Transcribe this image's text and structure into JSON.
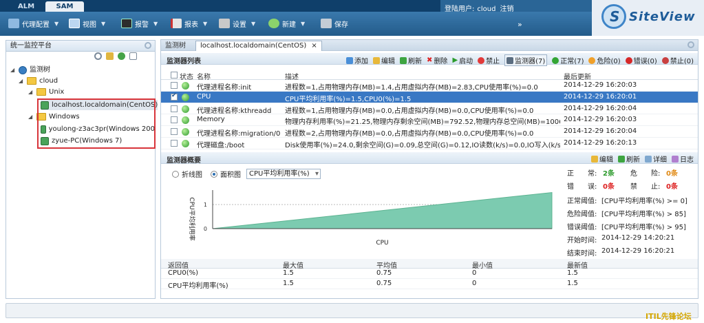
{
  "top_tabs": [
    "ALM",
    "SAM"
  ],
  "user": {
    "label": "登陆用户:",
    "name": "cloud",
    "logout": "注销"
  },
  "toolbar": {
    "items": [
      "代理配置",
      "视图",
      "报警",
      "报表",
      "设置",
      "新建",
      "保存"
    ],
    "expand": "»"
  },
  "logo": {
    "text": "SiteView"
  },
  "left_panel": {
    "title": "统一监控平台",
    "tree": [
      {
        "label": "监测树",
        "level": 0,
        "type": "root"
      },
      {
        "label": "cloud",
        "level": 1,
        "type": "folder"
      },
      {
        "label": "Unix",
        "level": 2,
        "type": "folder"
      },
      {
        "label": "localhost.localdomain(CentOS)",
        "level": 3,
        "type": "host",
        "selected": true
      },
      {
        "label": "Windows",
        "level": 2,
        "type": "folder"
      },
      {
        "label": "youlong-z3ac3pr(Windows 200",
        "level": 3,
        "type": "host"
      },
      {
        "label": "zyue-PC(Windows 7)",
        "level": 3,
        "type": "host"
      }
    ]
  },
  "main": {
    "tabs": [
      {
        "label": "监测树"
      },
      {
        "label": "localhost.localdomain(CentOS)",
        "close": "×"
      }
    ],
    "list": {
      "title": "监测器列表",
      "actions": [
        "添加",
        "编辑",
        "刷新",
        "删除",
        "启动",
        "禁止"
      ],
      "counts": {
        "monitor": "监测器(7)",
        "normal": "正常(7)",
        "danger": "危险(0)",
        "error": "错误(0)",
        "disabled": "禁止(0)"
      },
      "columns": [
        "状态",
        "名称",
        "描述",
        "最后更新"
      ],
      "rows": [
        {
          "name": "代理进程名称:init",
          "desc": "进程数=1,占用物理内存(MB)=1.4,占用虚拟内存(MB)=2.83,CPU使用率(%)=0.0",
          "time": "2014-12-29 16:20:03",
          "checked": false,
          "selected": false
        },
        {
          "name": "CPU",
          "desc": "CPU平均利用率(%)=1.5,CPU0(%)=1.5",
          "time": "2014-12-29 16:20:01",
          "checked": true,
          "selected": true
        },
        {
          "name": "代理进程名称:kthreadd",
          "desc": "进程数=1,占用物理内存(MB)=0.0,占用虚拟内存(MB)=0.0,CPU使用率(%)=0.0",
          "time": "2014-12-29 16:20:04",
          "checked": false,
          "selected": false
        },
        {
          "name": "Memory",
          "desc": "物理内存利用率(%)=21.25,物理内存剩余空间(MB)=792.52,物理内存总空间(MB)=1006.38,¢",
          "time": "2014-12-29 16:20:03",
          "checked": false,
          "selected": false
        },
        {
          "name": "代理进程名称:migration/0",
          "desc": "进程数=2,占用物理内存(MB)=0.0,占用虚拟内存(MB)=0.0,CPU使用率(%)=0.0",
          "time": "2014-12-29 16:20:04",
          "checked": false,
          "selected": false
        },
        {
          "name": "代理磁盘:/boot",
          "desc": "Disk使用率(%)=24.0,剩余空间(G)=0.09,总空间(G)=0.12,IO读数(k/s)=0.0,IO写入(k/s)=0.(",
          "time": "2014-12-29 16:20:13",
          "checked": false,
          "selected": false
        }
      ]
    },
    "summary": {
      "title": "监测器概要",
      "actions": [
        "编辑",
        "刷新",
        "详细",
        "日志"
      ],
      "view_line": "折线图",
      "view_area": "面积图",
      "metric_select": "CPU平均利用率(%)",
      "stats": {
        "normal_label": "正　　常:",
        "normal_value": "2条",
        "danger_label": "危　　险:",
        "danger_value": "0条",
        "error_label": "错　　误:",
        "error_value": "0条",
        "disabled_label": "禁　　止:",
        "disabled_value": "0条",
        "thresholds": [
          {
            "label": "正常阈值:",
            "value": "[CPU平均利用率(%) >= 0]"
          },
          {
            "label": "危险阈值:",
            "value": "[CPU平均利用率(%) > 85]"
          },
          {
            "label": "错误阈值:",
            "value": "[CPU平均利用率(%) > 95]"
          },
          {
            "label": "开始时间:",
            "value": "2014-12-29 14:20:21"
          },
          {
            "label": "结束时间:",
            "value": "2014-12-29 16:20:21"
          }
        ]
      },
      "table": {
        "columns": [
          "返回值",
          "最大值",
          "平均值",
          "最小值",
          "最新值"
        ],
        "rows": [
          [
            "CPU0(%)",
            "1.5",
            "0.75",
            "0",
            "1.5"
          ],
          [
            "CPU平均利用率(%)",
            "1.5",
            "0.75",
            "0",
            "1.5"
          ]
        ]
      }
    }
  },
  "chart_data": {
    "type": "area",
    "xlabel": "CPU",
    "ylabel": "CPU平均利用率",
    "x": [
      0,
      1
    ],
    "series": [
      {
        "values": [
          0,
          1.5
        ]
      }
    ],
    "ylim": [
      0,
      1.6
    ],
    "yticks": [
      "0",
      "1"
    ],
    "color": "#7ccbb0"
  },
  "watermark": "ITIL先锋论坛"
}
